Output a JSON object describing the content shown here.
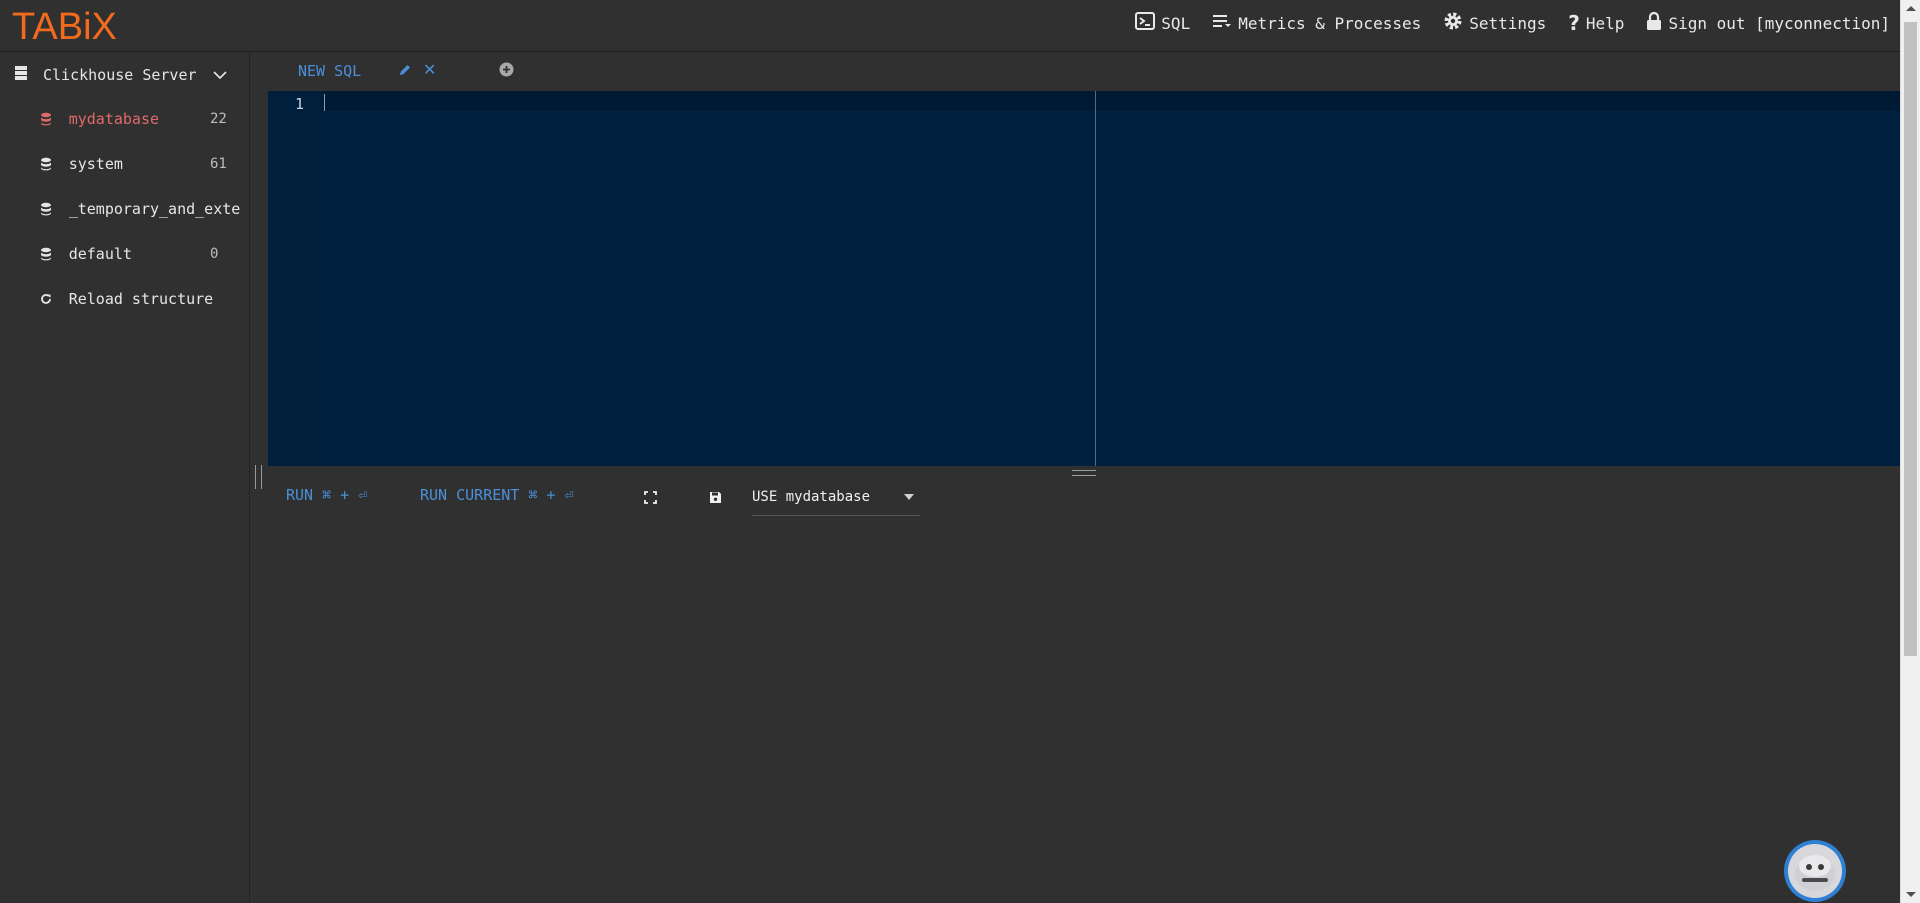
{
  "app": {
    "logo": "TABiX"
  },
  "topnav": {
    "sql": "SQL",
    "metrics": "Metrics & Processes",
    "settings": "Settings",
    "help": "Help",
    "signout": "Sign out [myconnection]"
  },
  "sidebar": {
    "server_label": "Clickhouse Server",
    "databases": [
      {
        "name": "mydatabase",
        "count": "22",
        "active": true
      },
      {
        "name": "system",
        "count": "61"
      },
      {
        "name": "_temporary_and_exte",
        "count": ""
      },
      {
        "name": "default",
        "count": "0"
      }
    ],
    "reload_label": "Reload structure"
  },
  "tabs": [
    {
      "label": "NEW SQL"
    }
  ],
  "editor": {
    "line_numbers": [
      "1"
    ],
    "content": ""
  },
  "toolbar": {
    "run_label": "RUN ⌘ + ⏎",
    "run_current_label": "RUN CURRENT ⌘ + ⏎",
    "database_select_value": "USE mydatabase"
  },
  "colors": {
    "brand": "#f26b1d",
    "accent": "#4a90d9",
    "active_db": "#e06a6a",
    "editor_bg": "#00203f"
  },
  "icons": [
    "terminal-icon",
    "list-icon",
    "gear-icon",
    "help-icon",
    "lock-icon",
    "server-icon",
    "chevron-down-icon",
    "database-icon",
    "reload-icon",
    "pencil-icon",
    "close-icon",
    "add-circle-icon",
    "fullscreen-icon",
    "save-icon",
    "bot-avatar-icon"
  ]
}
